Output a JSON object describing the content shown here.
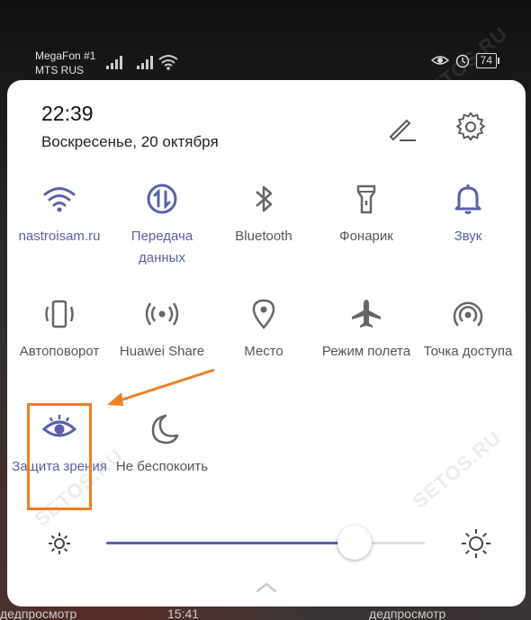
{
  "status_bar": {
    "carrier_1": "MegaFon #1",
    "carrier_2": "MTS RUS",
    "battery": "74"
  },
  "header": {
    "time": "22:39",
    "date": "Воскресенье, 20 октября"
  },
  "tiles_row1": [
    {
      "label": "nastroisam.ru",
      "icon": "wifi-icon",
      "active": true
    },
    {
      "label": "Передача данных",
      "icon": "data-transfer-icon",
      "active": true
    },
    {
      "label": "Bluetooth",
      "icon": "bluetooth-icon",
      "active": false
    },
    {
      "label": "Фонарик",
      "icon": "flashlight-icon",
      "active": false
    },
    {
      "label": "Звук",
      "icon": "bell-icon",
      "active": true
    }
  ],
  "tiles_row2": [
    {
      "label": "Автоповорот",
      "icon": "auto-rotate-icon",
      "active": false
    },
    {
      "label": "Huawei Share",
      "icon": "huawei-share-icon",
      "active": false
    },
    {
      "label": "Место",
      "icon": "location-icon",
      "active": false
    },
    {
      "label": "Режим полета",
      "icon": "airplane-icon",
      "active": false
    },
    {
      "label": "Точка доступа",
      "icon": "hotspot-icon",
      "active": false
    }
  ],
  "tiles_row3": [
    {
      "label": "Защита зрения",
      "icon": "eye-icon",
      "active": true
    },
    {
      "label": "Не беспокоить",
      "icon": "moon-icon",
      "active": false
    }
  ],
  "brightness": {
    "level": 0.78
  },
  "watermark": "SETOS.RU",
  "bottom_strip": [
    "дедпросмотр",
    "15:41",
    "дедпросмотр"
  ],
  "colors": {
    "accent": "#5a60a8",
    "inactive": "#555555",
    "highlight": "#f07f22"
  }
}
